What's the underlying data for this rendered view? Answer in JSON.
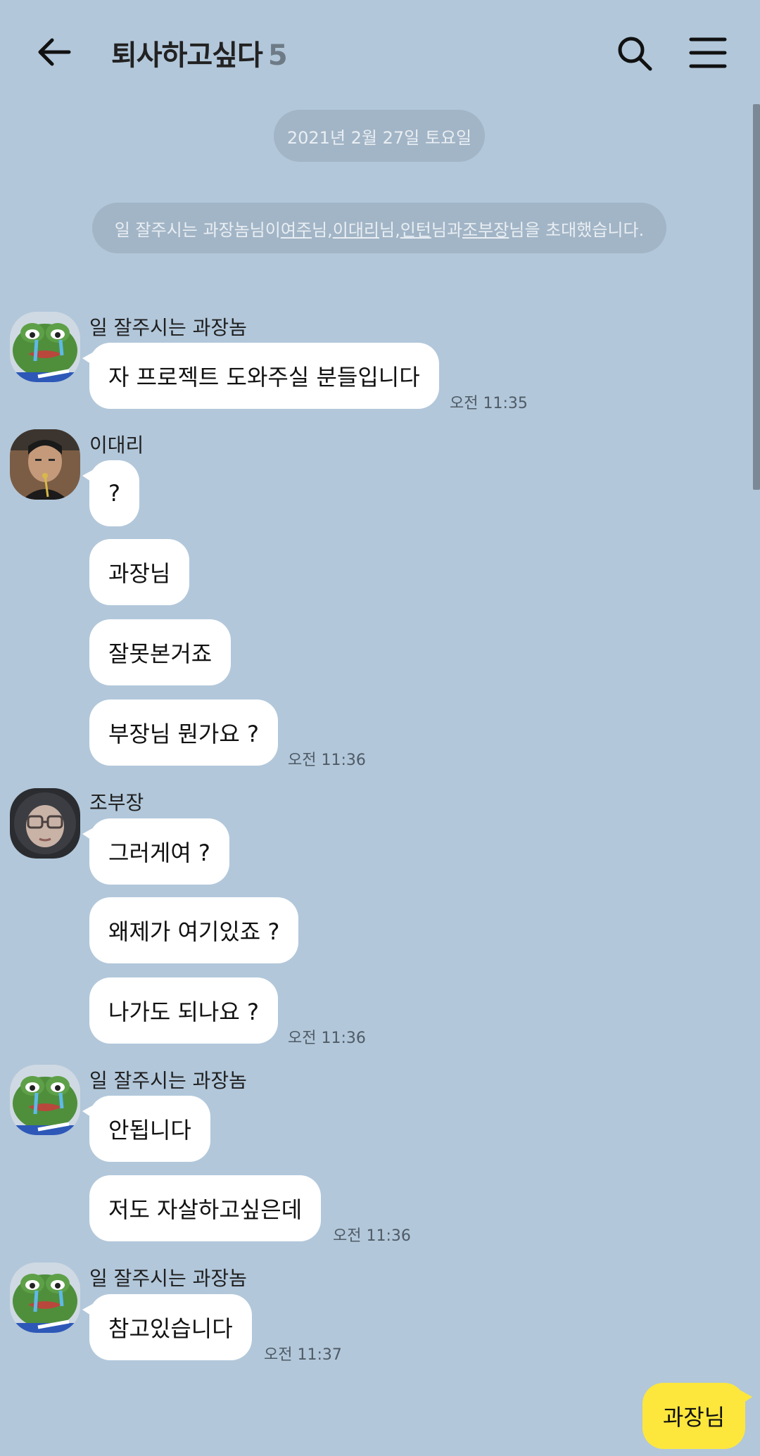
{
  "header": {
    "title": "퇴사하고싶다",
    "member_count": "5",
    "back_icon": "arrow-left-icon",
    "search_icon": "search-icon",
    "menu_icon": "hamburger-menu-icon"
  },
  "date_divider": "2021년 2월 27일 토요일",
  "system_message": {
    "prefix": "일 잘주시는 과장놈님이 ",
    "name1": "여주",
    "sep1": "님, ",
    "name2": "이대리",
    "sep2": "님, ",
    "name3": "인턴",
    "sep3": "님과 ",
    "name4": "조부장",
    "suffix": "님을 초대했습니다."
  },
  "messages": [
    {
      "sender": "일 잘주시는 과장놈",
      "avatar": "pepe-avatar",
      "bubbles": [
        "자 프로젝트 도와주실 분들입니다"
      ],
      "time": "오전 11:35"
    },
    {
      "sender": "이대리",
      "avatar": "man-photo-avatar",
      "bubbles": [
        "?",
        "과장님",
        "잘못본거죠",
        "부장님 뭔가요 ?"
      ],
      "time": "오전 11:36"
    },
    {
      "sender": "조부장",
      "avatar": "hood-glasses-avatar",
      "bubbles": [
        "그러게여 ?",
        "왜제가 여기있죠 ?",
        "나가도 되나요 ?"
      ],
      "time": "오전 11:36"
    },
    {
      "sender": "일 잘주시는 과장놈",
      "avatar": "pepe-avatar",
      "bubbles": [
        "안됩니다",
        "저도 자살하고싶은데"
      ],
      "time": "오전 11:36"
    },
    {
      "sender": "일 잘주시는 과장놈",
      "avatar": "pepe-avatar",
      "bubbles": [
        "참고있습니다"
      ],
      "time": "오전 11:37"
    }
  ],
  "my_message": "과장님",
  "colors": {
    "background": "#b2c7da",
    "my_bubble": "#fde73c",
    "other_bubble": "#ffffff"
  }
}
